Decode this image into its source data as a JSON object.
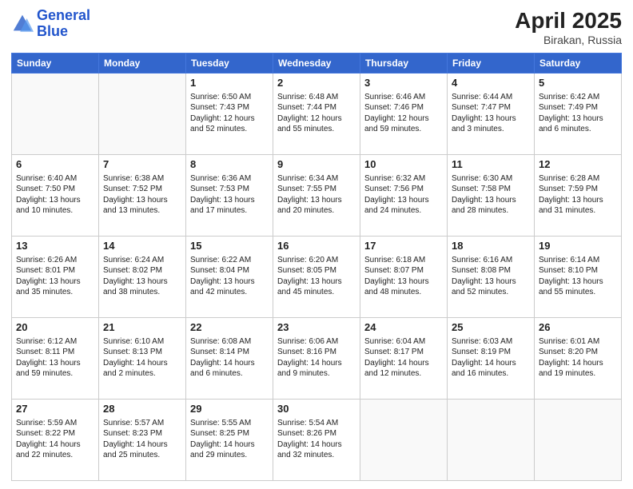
{
  "header": {
    "logo_line1": "General",
    "logo_line2": "Blue",
    "month": "April 2025",
    "location": "Birakan, Russia"
  },
  "days_of_week": [
    "Sunday",
    "Monday",
    "Tuesday",
    "Wednesday",
    "Thursday",
    "Friday",
    "Saturday"
  ],
  "weeks": [
    [
      {
        "day": "",
        "empty": true
      },
      {
        "day": "",
        "empty": true
      },
      {
        "day": "1",
        "lines": [
          "Sunrise: 6:50 AM",
          "Sunset: 7:43 PM",
          "Daylight: 12 hours",
          "and 52 minutes."
        ]
      },
      {
        "day": "2",
        "lines": [
          "Sunrise: 6:48 AM",
          "Sunset: 7:44 PM",
          "Daylight: 12 hours",
          "and 55 minutes."
        ]
      },
      {
        "day": "3",
        "lines": [
          "Sunrise: 6:46 AM",
          "Sunset: 7:46 PM",
          "Daylight: 12 hours",
          "and 59 minutes."
        ]
      },
      {
        "day": "4",
        "lines": [
          "Sunrise: 6:44 AM",
          "Sunset: 7:47 PM",
          "Daylight: 13 hours",
          "and 3 minutes."
        ]
      },
      {
        "day": "5",
        "lines": [
          "Sunrise: 6:42 AM",
          "Sunset: 7:49 PM",
          "Daylight: 13 hours",
          "and 6 minutes."
        ]
      }
    ],
    [
      {
        "day": "6",
        "lines": [
          "Sunrise: 6:40 AM",
          "Sunset: 7:50 PM",
          "Daylight: 13 hours",
          "and 10 minutes."
        ]
      },
      {
        "day": "7",
        "lines": [
          "Sunrise: 6:38 AM",
          "Sunset: 7:52 PM",
          "Daylight: 13 hours",
          "and 13 minutes."
        ]
      },
      {
        "day": "8",
        "lines": [
          "Sunrise: 6:36 AM",
          "Sunset: 7:53 PM",
          "Daylight: 13 hours",
          "and 17 minutes."
        ]
      },
      {
        "day": "9",
        "lines": [
          "Sunrise: 6:34 AM",
          "Sunset: 7:55 PM",
          "Daylight: 13 hours",
          "and 20 minutes."
        ]
      },
      {
        "day": "10",
        "lines": [
          "Sunrise: 6:32 AM",
          "Sunset: 7:56 PM",
          "Daylight: 13 hours",
          "and 24 minutes."
        ]
      },
      {
        "day": "11",
        "lines": [
          "Sunrise: 6:30 AM",
          "Sunset: 7:58 PM",
          "Daylight: 13 hours",
          "and 28 minutes."
        ]
      },
      {
        "day": "12",
        "lines": [
          "Sunrise: 6:28 AM",
          "Sunset: 7:59 PM",
          "Daylight: 13 hours",
          "and 31 minutes."
        ]
      }
    ],
    [
      {
        "day": "13",
        "lines": [
          "Sunrise: 6:26 AM",
          "Sunset: 8:01 PM",
          "Daylight: 13 hours",
          "and 35 minutes."
        ]
      },
      {
        "day": "14",
        "lines": [
          "Sunrise: 6:24 AM",
          "Sunset: 8:02 PM",
          "Daylight: 13 hours",
          "and 38 minutes."
        ]
      },
      {
        "day": "15",
        "lines": [
          "Sunrise: 6:22 AM",
          "Sunset: 8:04 PM",
          "Daylight: 13 hours",
          "and 42 minutes."
        ]
      },
      {
        "day": "16",
        "lines": [
          "Sunrise: 6:20 AM",
          "Sunset: 8:05 PM",
          "Daylight: 13 hours",
          "and 45 minutes."
        ]
      },
      {
        "day": "17",
        "lines": [
          "Sunrise: 6:18 AM",
          "Sunset: 8:07 PM",
          "Daylight: 13 hours",
          "and 48 minutes."
        ]
      },
      {
        "day": "18",
        "lines": [
          "Sunrise: 6:16 AM",
          "Sunset: 8:08 PM",
          "Daylight: 13 hours",
          "and 52 minutes."
        ]
      },
      {
        "day": "19",
        "lines": [
          "Sunrise: 6:14 AM",
          "Sunset: 8:10 PM",
          "Daylight: 13 hours",
          "and 55 minutes."
        ]
      }
    ],
    [
      {
        "day": "20",
        "lines": [
          "Sunrise: 6:12 AM",
          "Sunset: 8:11 PM",
          "Daylight: 13 hours",
          "and 59 minutes."
        ]
      },
      {
        "day": "21",
        "lines": [
          "Sunrise: 6:10 AM",
          "Sunset: 8:13 PM",
          "Daylight: 14 hours",
          "and 2 minutes."
        ]
      },
      {
        "day": "22",
        "lines": [
          "Sunrise: 6:08 AM",
          "Sunset: 8:14 PM",
          "Daylight: 14 hours",
          "and 6 minutes."
        ]
      },
      {
        "day": "23",
        "lines": [
          "Sunrise: 6:06 AM",
          "Sunset: 8:16 PM",
          "Daylight: 14 hours",
          "and 9 minutes."
        ]
      },
      {
        "day": "24",
        "lines": [
          "Sunrise: 6:04 AM",
          "Sunset: 8:17 PM",
          "Daylight: 14 hours",
          "and 12 minutes."
        ]
      },
      {
        "day": "25",
        "lines": [
          "Sunrise: 6:03 AM",
          "Sunset: 8:19 PM",
          "Daylight: 14 hours",
          "and 16 minutes."
        ]
      },
      {
        "day": "26",
        "lines": [
          "Sunrise: 6:01 AM",
          "Sunset: 8:20 PM",
          "Daylight: 14 hours",
          "and 19 minutes."
        ]
      }
    ],
    [
      {
        "day": "27",
        "lines": [
          "Sunrise: 5:59 AM",
          "Sunset: 8:22 PM",
          "Daylight: 14 hours",
          "and 22 minutes."
        ]
      },
      {
        "day": "28",
        "lines": [
          "Sunrise: 5:57 AM",
          "Sunset: 8:23 PM",
          "Daylight: 14 hours",
          "and 25 minutes."
        ]
      },
      {
        "day": "29",
        "lines": [
          "Sunrise: 5:55 AM",
          "Sunset: 8:25 PM",
          "Daylight: 14 hours",
          "and 29 minutes."
        ]
      },
      {
        "day": "30",
        "lines": [
          "Sunrise: 5:54 AM",
          "Sunset: 8:26 PM",
          "Daylight: 14 hours",
          "and 32 minutes."
        ]
      },
      {
        "day": "",
        "empty": true
      },
      {
        "day": "",
        "empty": true
      },
      {
        "day": "",
        "empty": true
      }
    ]
  ]
}
